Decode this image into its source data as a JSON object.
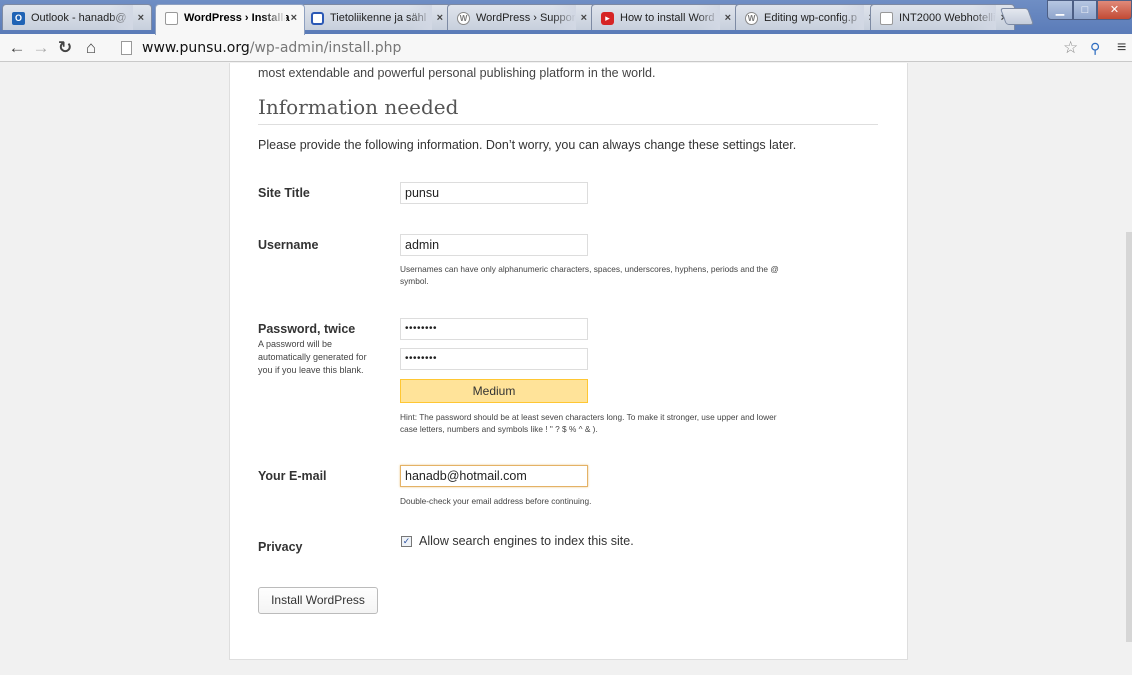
{
  "browser": {
    "tabs": [
      {
        "title": "Outlook - hanadb@",
        "favicon": "outlook-icon"
      },
      {
        "title": "WordPress › Installa",
        "favicon": "page-icon"
      },
      {
        "title": "Tietoliikenne ja sähl",
        "favicon": "blue-square-icon"
      },
      {
        "title": "WordPress › Suppor",
        "favicon": "wordpress-icon"
      },
      {
        "title": "How to install Word",
        "favicon": "youtube-icon"
      },
      {
        "title": "Editing wp-config.p",
        "favicon": "wordpress-icon"
      },
      {
        "title": "INT2000 Webhotelli",
        "favicon": "page-icon"
      }
    ],
    "url_host": "www.punsu.org",
    "url_path": "/wp-admin/install.php"
  },
  "page": {
    "intro": "most extendable and powerful personal publishing platform in the world.",
    "heading": "Information needed",
    "provide": "Please provide the following information. Don’t worry, you can always change these settings later.",
    "site_title": {
      "label": "Site Title",
      "value": "punsu"
    },
    "username": {
      "label": "Username",
      "value": "admin",
      "hint_line1": "Usernames can have only alphanumeric characters, spaces, underscores, hyphens, periods and the @",
      "hint_line2": "symbol."
    },
    "password": {
      "label": "Password, twice",
      "sub_line1": "A password will be",
      "sub_line2": "automatically generated for",
      "sub_line3": "you if you leave this blank.",
      "value1": "••••••••",
      "value2": "••••••••",
      "strength": "Medium",
      "hint_line1": "Hint: The password should be at least seven characters long. To make it stronger, use upper and lower",
      "hint_line2": "case letters, numbers and symbols like ! \" ? $ % ^ & )."
    },
    "email": {
      "label": "Your E-mail",
      "value": "hanadb@hotmail.com",
      "hint": "Double-check your email address before continuing."
    },
    "privacy": {
      "label": "Privacy",
      "checkbox_label": "Allow search engines to index this site.",
      "checked": true
    },
    "install_button": "Install WordPress"
  },
  "colors": {
    "strength_meter": "#ffe399",
    "focus_border": "#e4b266"
  }
}
